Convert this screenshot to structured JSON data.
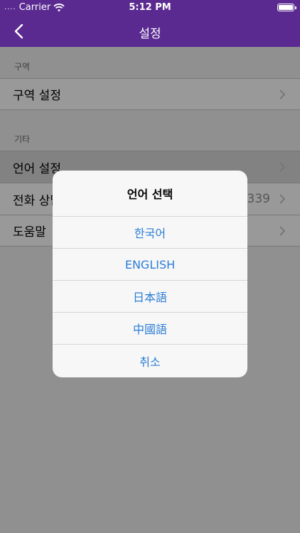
{
  "status_bar": {
    "signal": "....",
    "carrier": "Carrier",
    "time": "5:12 PM"
  },
  "nav": {
    "title": "설정",
    "back_icon": "chevron-left-icon"
  },
  "sections": [
    {
      "header": "구역",
      "rows": [
        {
          "label": "구역 설정",
          "value": ""
        }
      ]
    },
    {
      "header": "기타",
      "rows": [
        {
          "label": "언어 설정",
          "value": ""
        },
        {
          "label": "전화 상담",
          "value": "339"
        },
        {
          "label": "도움말",
          "value": ""
        }
      ]
    }
  ],
  "alert": {
    "title": "언어 선택",
    "options": [
      "한국어",
      "ENGLISH",
      "日本語",
      "中國語",
      "취소"
    ]
  },
  "colors": {
    "accent": "#5a2a91",
    "link": "#2a7dd6"
  }
}
